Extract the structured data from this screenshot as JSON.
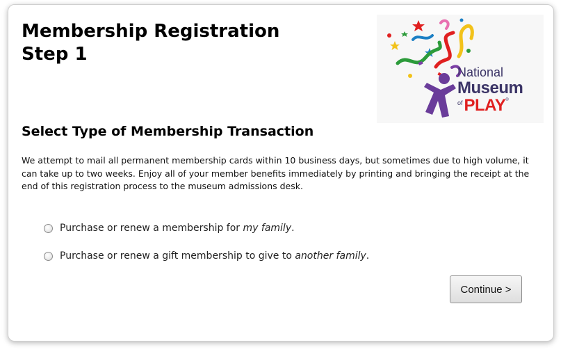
{
  "page": {
    "title_line1": "Membership Registration",
    "title_line2": "Step 1"
  },
  "logo": {
    "line1": "National",
    "line2": "Museum",
    "line3_small": "of",
    "line3_main": "PLAY",
    "registered": "®",
    "colors": {
      "text": "#3b3466",
      "play": "#e02020",
      "confetti": [
        "#e02020",
        "#2c9b3a",
        "#1c7fc4",
        "#f2c21a",
        "#7b3fa5",
        "#e86fb0"
      ]
    }
  },
  "section": {
    "heading": "Select Type of Membership Transaction",
    "intro": "We attempt to mail all permanent membership cards within 10 business days, but sometimes due to high volume, it can take up to two weeks. Enjoy all of your member benefits immediately by printing and bringing the receipt at the end of this registration process to the museum admissions desk."
  },
  "options": [
    {
      "prefix": "Purchase or renew a membership for ",
      "emphasis": "my family",
      "suffix": ".",
      "selected": false
    },
    {
      "prefix": "Purchase or renew a gift membership to give to ",
      "emphasis": "another family",
      "suffix": ".",
      "selected": false
    }
  ],
  "buttons": {
    "continue_label": "Continue >"
  }
}
